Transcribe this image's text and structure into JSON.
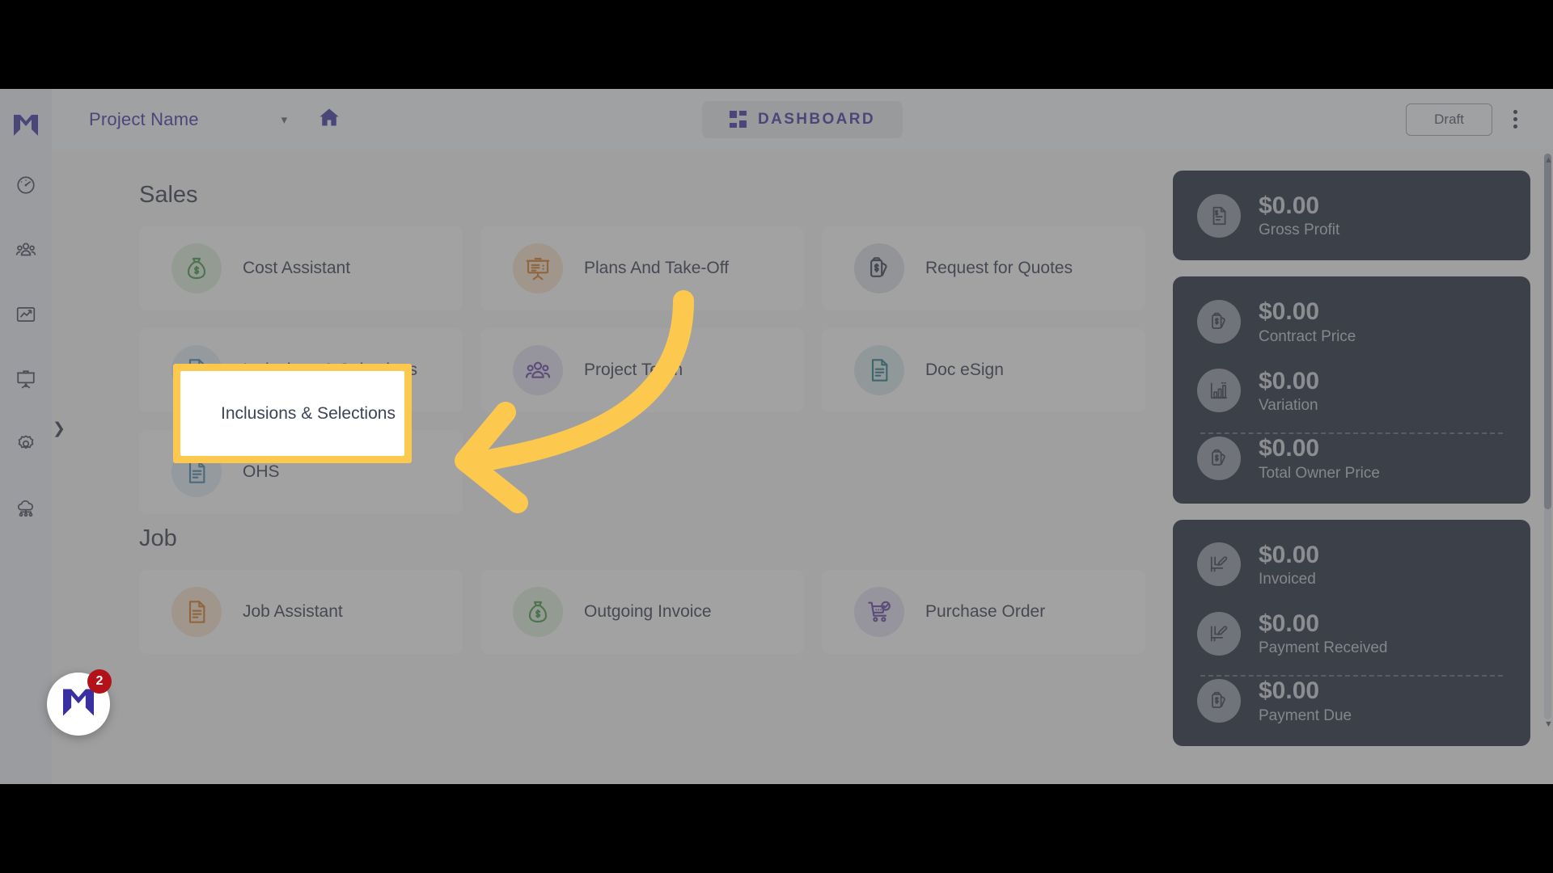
{
  "header": {
    "project_name": "Project Name",
    "caret_icon": "chevron-down-icon",
    "home_icon": "home-icon",
    "dashboard_label": "DASHBOARD",
    "dashboard_icon": "grid-icon",
    "draft_label": "Draft",
    "kebab_icon": "more-vertical-icon"
  },
  "sidebar": {
    "logo_icon": "mastt-logo-icon",
    "items": [
      {
        "icon": "speedometer-icon",
        "name": "dashboard"
      },
      {
        "icon": "people-group-icon",
        "name": "team"
      },
      {
        "icon": "chart-line-icon",
        "name": "reports"
      },
      {
        "icon": "presentation-board-icon",
        "name": "presentations"
      },
      {
        "icon": "gear-icon",
        "name": "settings"
      },
      {
        "icon": "cloud-network-icon",
        "name": "integrations"
      }
    ],
    "expander_icon": "chevron-right-icon"
  },
  "sections": [
    {
      "title": "Sales",
      "cards": [
        {
          "label": "Cost Assistant",
          "icon": "money-bag-icon",
          "icon_color": "#3f9247",
          "circle_color": "#d9ecd8"
        },
        {
          "label": "Plans And Take-Off",
          "icon": "presentation-board-icon",
          "icon_color": "#d2761d",
          "circle_color": "#f5dfc8"
        },
        {
          "label": "Request for Quotes",
          "icon": "price-tag-icon",
          "icon_color": "#2f3548",
          "circle_color": "#d8dbe4"
        },
        {
          "label": "Inclusions & Selections",
          "icon": "document-icon",
          "icon_color": "#3f7fa8",
          "circle_color": "#dbe8f2"
        },
        {
          "label": "Project Team",
          "icon": "people-group-icon",
          "icon_color": "#5b3fa0",
          "circle_color": "#e0dcef"
        },
        {
          "label": "Doc eSign",
          "icon": "document-icon",
          "icon_color": "#237585",
          "circle_color": "#d5e4e8"
        },
        {
          "label": "OHS",
          "icon": "document-icon",
          "icon_color": "#3f7fa8",
          "circle_color": "#dbe8f2"
        }
      ]
    },
    {
      "title": "Job",
      "cards": [
        {
          "label": "Job Assistant",
          "icon": "document-icon",
          "icon_color": "#d2761d",
          "circle_color": "#f5dfc8"
        },
        {
          "label": "Outgoing Invoice",
          "icon": "money-bag-icon",
          "icon_color": "#3f9247",
          "circle_color": "#d9ecd8"
        },
        {
          "label": "Purchase Order",
          "icon": "shopping-cart-icon",
          "icon_color": "#5b3fa0",
          "circle_color": "#e0dcef"
        }
      ]
    }
  ],
  "metrics": {
    "groups": [
      {
        "rows": [
          {
            "value": "$0.00",
            "label": "Gross Profit",
            "icon": "document-dollar-icon"
          }
        ]
      },
      {
        "rows": [
          {
            "value": "$0.00",
            "label": "Contract Price",
            "icon": "price-tag-icon"
          },
          {
            "value": "$0.00",
            "label": "Variation",
            "icon": "bar-chart-icon",
            "divider_after": true
          },
          {
            "value": "$0.00",
            "label": "Total Owner Price",
            "icon": "price-tag-icon"
          }
        ]
      },
      {
        "rows": [
          {
            "value": "$0.00",
            "label": "Invoiced",
            "icon": "invoice-edit-icon"
          },
          {
            "value": "$0.00",
            "label": "Payment Received",
            "icon": "invoice-edit-icon",
            "divider_after": true
          },
          {
            "value": "$0.00",
            "label": "Payment Due",
            "icon": "price-tag-icon"
          }
        ]
      }
    ]
  },
  "chat": {
    "badge_count": "2",
    "icon": "mastt-logo-icon"
  },
  "annotation": {
    "highlight_label": "Inclusions & Selections",
    "highlight_color": "#fcc94e",
    "arrow_color": "#fcc94e",
    "arrow_icon": "curved-left-arrow-icon"
  },
  "scrollbar": {
    "up_icon": "caret-up-icon",
    "down_icon": "caret-down-icon"
  }
}
